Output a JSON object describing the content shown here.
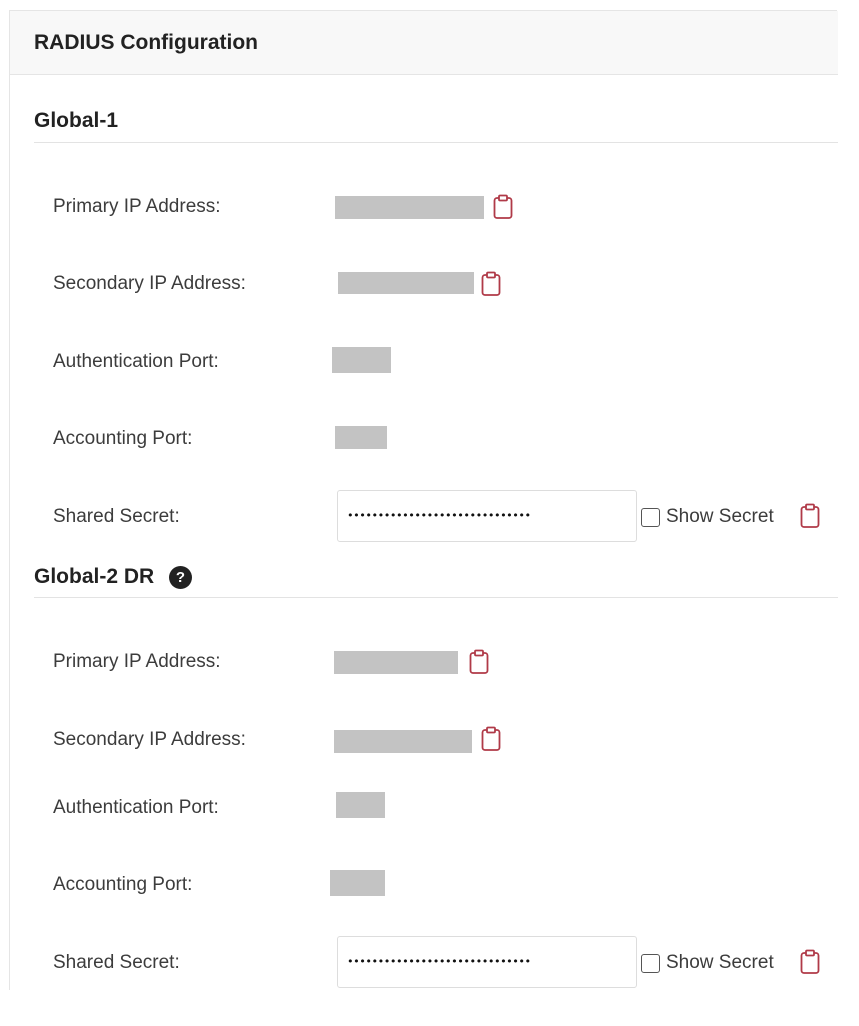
{
  "panel": {
    "title": "RADIUS Configuration"
  },
  "sections": [
    {
      "title": "Global-1",
      "has_help": false,
      "fields": {
        "primary_ip_label": "Primary IP Address:",
        "secondary_ip_label": "Secondary IP Address:",
        "auth_port_label": "Authentication Port:",
        "acct_port_label": "Accounting Port:",
        "shared_secret_label": "Shared Secret:",
        "shared_secret_value": "••••••••••••••••••••••••••••••",
        "show_secret_label": "Show Secret",
        "show_secret_checked": false
      }
    },
    {
      "title": "Global-2 DR",
      "has_help": true,
      "help_symbol": "?",
      "fields": {
        "primary_ip_label": "Primary IP Address:",
        "secondary_ip_label": "Secondary IP Address:",
        "auth_port_label": "Authentication Port:",
        "acct_port_label": "Accounting Port:",
        "shared_secret_label": "Shared Secret:",
        "shared_secret_value": "••••••••••••••••••••••••••••••",
        "show_secret_label": "Show Secret",
        "show_secret_checked": false
      }
    }
  ],
  "icons": {
    "copy": "clipboard-icon",
    "help": "question-circle-icon",
    "checkbox": "checkbox-unchecked"
  },
  "colors": {
    "accent_red": "#b03a48",
    "redacted_gray": "#c3c3c3",
    "header_bg": "#f8f8f8"
  }
}
